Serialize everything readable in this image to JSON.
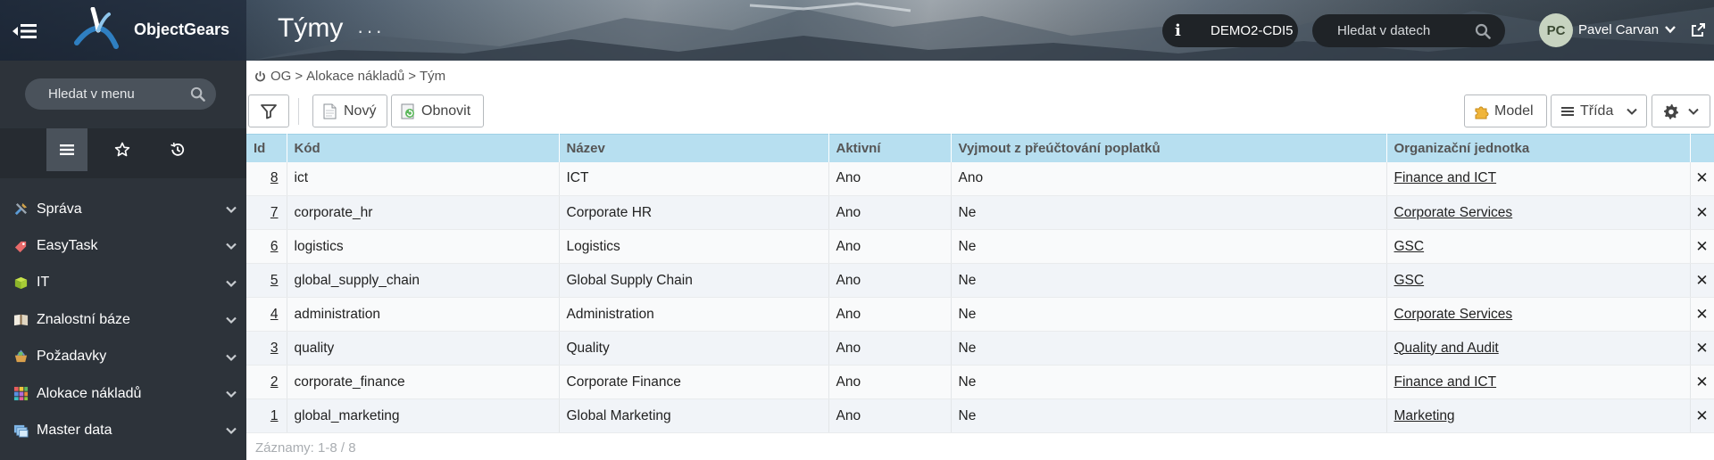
{
  "header": {
    "brand": "ObjectGears",
    "page_title": "Týmy",
    "title_menu": "···",
    "environment": "DEMO2-CDI5",
    "search_placeholder": "Hledat v datech",
    "user_initials": "PC",
    "user_name": "Pavel Carvan"
  },
  "sidebar": {
    "search_placeholder": "Hledat v menu",
    "tabs": [
      "menu",
      "favorites",
      "history"
    ],
    "items": [
      {
        "label": "Správa",
        "icon": "tools-icon"
      },
      {
        "label": "EasyTask",
        "icon": "tag-icon"
      },
      {
        "label": "IT",
        "icon": "box-icon"
      },
      {
        "label": "Znalostní báze",
        "icon": "book-icon"
      },
      {
        "label": "Požadavky",
        "icon": "basket-icon"
      },
      {
        "label": "Alokace nákladů",
        "icon": "blocks-icon"
      },
      {
        "label": "Master data",
        "icon": "stack-icon"
      }
    ]
  },
  "breadcrumb": {
    "root": "OG",
    "level1": "Alokace nákladů",
    "current": "Tým",
    "sep": ">"
  },
  "toolbar": {
    "new_label": "Nový",
    "refresh_label": "Obnovit",
    "model_label": "Model",
    "class_label": "Třída"
  },
  "table": {
    "columns": [
      "Id",
      "Kód",
      "Název",
      "Aktivní",
      "Vyjmout z přeúčtování poplatků",
      "Organizační jednotka"
    ],
    "rows": [
      {
        "id": "8",
        "code": "ict",
        "name": "ICT",
        "active": "Ano",
        "exclude": "Ano",
        "org": "Finance and ICT"
      },
      {
        "id": "7",
        "code": "corporate_hr",
        "name": "Corporate HR",
        "active": "Ano",
        "exclude": "Ne",
        "org": "Corporate Services"
      },
      {
        "id": "6",
        "code": "logistics",
        "name": "Logistics",
        "active": "Ano",
        "exclude": "Ne",
        "org": "GSC"
      },
      {
        "id": "5",
        "code": "global_supply_chain",
        "name": "Global Supply Chain",
        "active": "Ano",
        "exclude": "Ne",
        "org": "GSC"
      },
      {
        "id": "4",
        "code": "administration",
        "name": "Administration",
        "active": "Ano",
        "exclude": "Ne",
        "org": "Corporate Services"
      },
      {
        "id": "3",
        "code": "quality",
        "name": "Quality",
        "active": "Ano",
        "exclude": "Ne",
        "org": "Quality and Audit"
      },
      {
        "id": "2",
        "code": "corporate_finance",
        "name": "Corporate Finance",
        "active": "Ano",
        "exclude": "Ne",
        "org": "Finance and ICT"
      },
      {
        "id": "1",
        "code": "global_marketing",
        "name": "Global Marketing",
        "active": "Ano",
        "exclude": "Ne",
        "org": "Marketing"
      }
    ],
    "delete_glyph": "✕"
  },
  "footer": {
    "records": "Záznamy: 1-8 / 8"
  }
}
